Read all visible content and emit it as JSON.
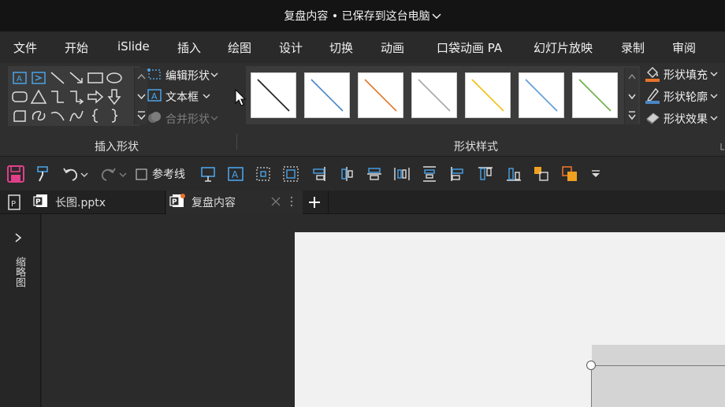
{
  "window": {
    "title": "复盘内容 • 已保存到这台电脑"
  },
  "menu": {
    "items": [
      "文件",
      "开始",
      "iSlide",
      "插入",
      "绘图",
      "设计",
      "切换",
      "动画",
      "口袋动画 PA",
      "幻灯片放映",
      "录制",
      "审阅"
    ]
  },
  "ribbon": {
    "insert_shapes": {
      "label": "插入形状",
      "edit_shape": "编辑形状",
      "text_box": "文本框",
      "merge_shapes": "合并形状"
    },
    "shape_styles": {
      "label": "形状样式",
      "fill": "形状填充",
      "outline": "形状轮廓",
      "effects": "形状效果",
      "line_colors": [
        "#1a1a1a",
        "#4a86c5",
        "#e07a2e",
        "#a6a6a6",
        "#f2c012",
        "#5b9bd5",
        "#6aad45"
      ]
    }
  },
  "quick_access": {
    "guides_label": "参考线"
  },
  "tabs": [
    {
      "label": "长图.pptx"
    },
    {
      "label": "复盘内容"
    }
  ],
  "left_panel": {
    "label": "缩略图"
  },
  "colors": {
    "accent": "#c43e1c",
    "save_icon": "#e0408a",
    "icon_blue": "#4aa3e8"
  }
}
